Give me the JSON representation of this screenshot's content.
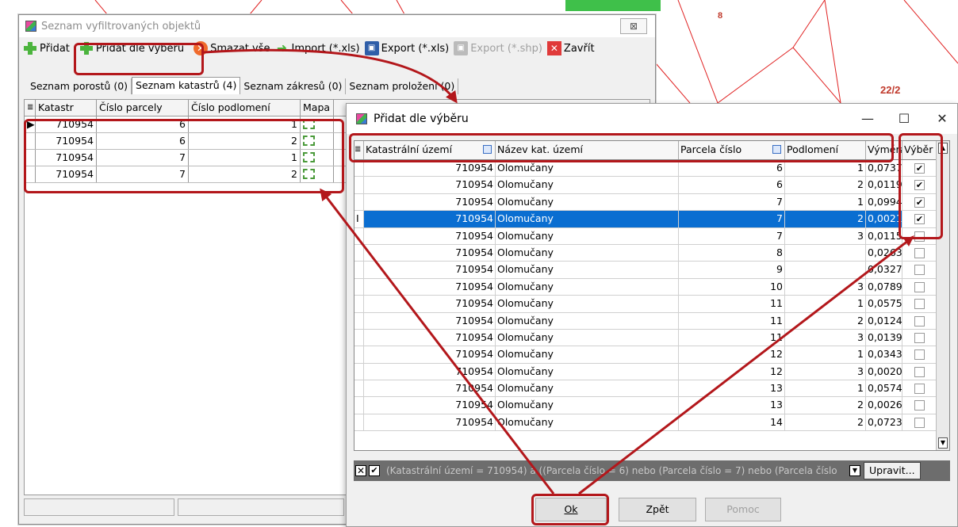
{
  "map_labels": [
    "8",
    "22/2"
  ],
  "main_window": {
    "title": "Seznam vyfiltrovaných objektů",
    "close_label": "⊠",
    "toolbar": {
      "add": "Přidat",
      "add_by_selection": "Přidat dle výběru",
      "delete_all": "Smazat vše",
      "import": "Import (*.xls)",
      "export_xls": "Export (*.xls)",
      "export_shp": "Export (*.shp)",
      "close": "Zavřít"
    },
    "tabs": [
      "Seznam porostů (0)",
      "Seznam katastrů (4)",
      "Seznam zákresů (0)",
      "Seznam proložení (0)"
    ],
    "grid": {
      "columns": [
        "Katastr",
        "Číslo parcely",
        "Číslo podlomení",
        "Mapa"
      ],
      "rows": [
        {
          "katastr": "710954",
          "parcela": "6",
          "podlomeni": "1"
        },
        {
          "katastr": "710954",
          "parcela": "6",
          "podlomeni": "2"
        },
        {
          "katastr": "710954",
          "parcela": "7",
          "podlomeni": "1"
        },
        {
          "katastr": "710954",
          "parcela": "7",
          "podlomeni": "2"
        }
      ]
    }
  },
  "dialog": {
    "title": "Přidat dle výběru",
    "columns": [
      "Katastrální území",
      "Název kat. území",
      "Parcela číslo",
      "Podlomení",
      "Výměra",
      "Výběr"
    ],
    "rows": [
      {
        "ku": "710954",
        "nazev": "Olomučany",
        "parcela": "6",
        "podl": "1",
        "vymera": "0,0737",
        "vyber": true
      },
      {
        "ku": "710954",
        "nazev": "Olomučany",
        "parcela": "6",
        "podl": "2",
        "vymera": "0,0119",
        "vyber": true
      },
      {
        "ku": "710954",
        "nazev": "Olomučany",
        "parcela": "7",
        "podl": "1",
        "vymera": "0,0994",
        "vyber": true
      },
      {
        "ku": "710954",
        "nazev": "Olomučany",
        "parcela": "7",
        "podl": "2",
        "vymera": "0,0021",
        "vyber": true
      },
      {
        "ku": "710954",
        "nazev": "Olomučany",
        "parcela": "7",
        "podl": "3",
        "vymera": "0,0115",
        "vyber": false
      },
      {
        "ku": "710954",
        "nazev": "Olomučany",
        "parcela": "8",
        "podl": "",
        "vymera": "0,0263",
        "vyber": false
      },
      {
        "ku": "710954",
        "nazev": "Olomučany",
        "parcela": "9",
        "podl": "",
        "vymera": "0,0327",
        "vyber": false
      },
      {
        "ku": "710954",
        "nazev": "Olomučany",
        "parcela": "10",
        "podl": "3",
        "vymera": "0,0789",
        "vyber": false
      },
      {
        "ku": "710954",
        "nazev": "Olomučany",
        "parcela": "11",
        "podl": "1",
        "vymera": "0,0575",
        "vyber": false
      },
      {
        "ku": "710954",
        "nazev": "Olomučany",
        "parcela": "11",
        "podl": "2",
        "vymera": "0,0124",
        "vyber": false
      },
      {
        "ku": "710954",
        "nazev": "Olomučany",
        "parcela": "11",
        "podl": "3",
        "vymera": "0,0139",
        "vyber": false
      },
      {
        "ku": "710954",
        "nazev": "Olomučany",
        "parcela": "12",
        "podl": "1",
        "vymera": "0,0343",
        "vyber": false
      },
      {
        "ku": "710954",
        "nazev": "Olomučany",
        "parcela": "12",
        "podl": "3",
        "vymera": "0,0020",
        "vyber": false
      },
      {
        "ku": "710954",
        "nazev": "Olomučany",
        "parcela": "13",
        "podl": "1",
        "vymera": "0,0574",
        "vyber": false
      },
      {
        "ku": "710954",
        "nazev": "Olomučany",
        "parcela": "13",
        "podl": "2",
        "vymera": "0,0026",
        "vyber": false
      },
      {
        "ku": "710954",
        "nazev": "Olomučany",
        "parcela": "14",
        "podl": "2",
        "vymera": "0,0723",
        "vyber": false
      }
    ],
    "filter_text": "(Katastrální území = 710954) a ((Parcela číslo = 6) nebo (Parcela číslo = 7) nebo (Parcela číslo",
    "edit_button": "Upravit...",
    "buttons": {
      "ok": "Ok",
      "back": "Zpět",
      "help": "Pomoc"
    },
    "selected_row": 3
  },
  "colors": {
    "annotation": "#b3171b",
    "selection": "#0a6ed1",
    "map_line": "#e02020"
  }
}
